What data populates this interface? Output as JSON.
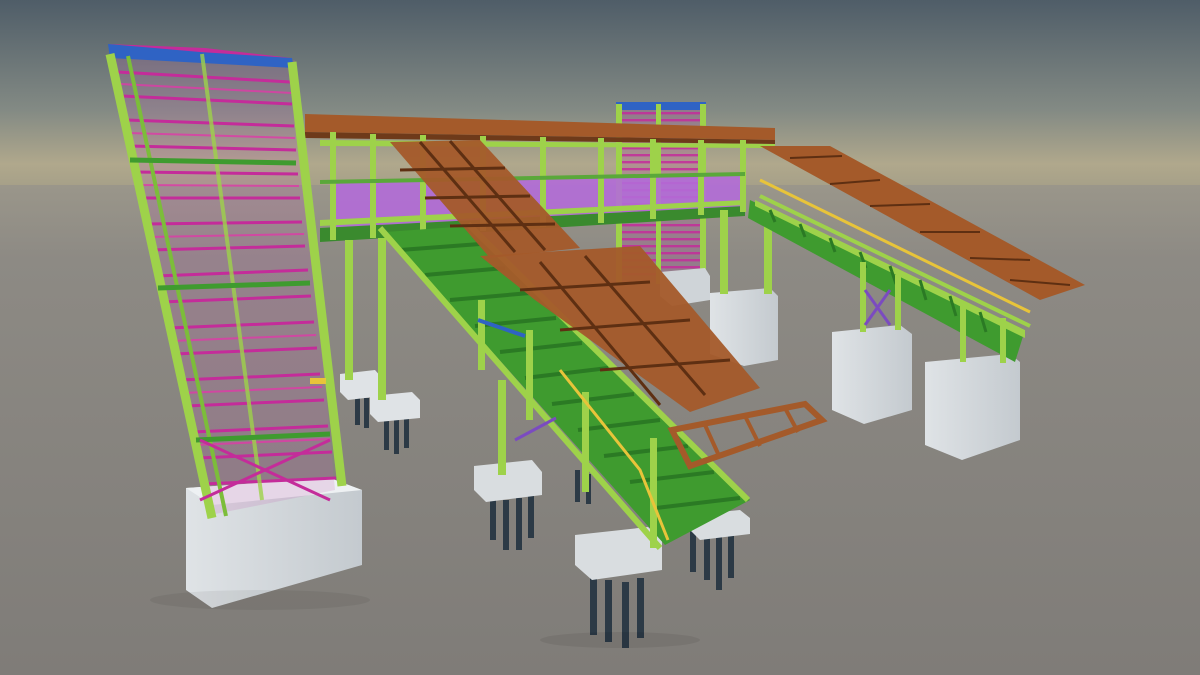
{
  "scene": {
    "colors": {
      "sky_top": "#4e5c66",
      "sky_horizon": "#a9a48c",
      "ground": "#8b8883",
      "primary_steel": "#9ed24a",
      "bracing_magenta": "#c42c9a",
      "stair_tread_green": "#3f9b2f",
      "deck_timber_brown": "#a45a2a",
      "canopy_roof_blue": "#2f63c4",
      "walkway_panel_violet": "#b36bd8",
      "concrete_footing": "#d4dadf",
      "pile_dark": "#2c3a46",
      "handrail_yellow": "#e8c43a",
      "cross_brace_purple": "#7b4bc0"
    },
    "components": [
      {
        "name": "lift-tower-left",
        "label": ""
      },
      {
        "name": "lift-tower-rear",
        "label": ""
      },
      {
        "name": "overhead-bridge-span",
        "label": ""
      },
      {
        "name": "staircase-main",
        "label": ""
      },
      {
        "name": "staircase-right",
        "label": ""
      },
      {
        "name": "concrete-footings",
        "label": ""
      },
      {
        "name": "foundation-piles",
        "label": ""
      }
    ]
  }
}
